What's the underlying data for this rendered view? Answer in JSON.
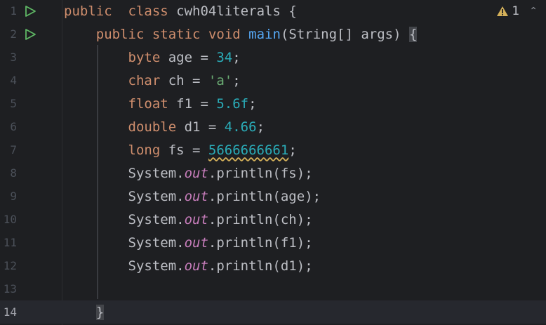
{
  "inspection": {
    "warning_count": "1",
    "warning_icon": "warning-triangle-icon",
    "nav_icon": "chevron-up-icon"
  },
  "colors": {
    "background": "#1e1f22",
    "keyword": "#cf8e6d",
    "number": "#2aacb8",
    "string": "#6aab73",
    "method": "#56a8f5",
    "static_field": "#c77dbb",
    "run_icon": "#5fb865",
    "warning": "#d5b15a"
  },
  "lines": [
    {
      "num": "1",
      "run": true,
      "tokens": [
        [
          "kw",
          "public"
        ],
        [
          "",
          "  "
        ],
        [
          "kw",
          "class"
        ],
        [
          "",
          " cwh04literals {"
        ]
      ]
    },
    {
      "num": "2",
      "run": true,
      "tokens": [
        [
          "",
          "    "
        ],
        [
          "kw",
          "public"
        ],
        [
          "",
          " "
        ],
        [
          "kw",
          "static"
        ],
        [
          "",
          " "
        ],
        [
          "kw",
          "void"
        ],
        [
          "",
          " "
        ],
        [
          "fn",
          "main"
        ],
        [
          "",
          "(String[] args) "
        ],
        [
          "brace",
          "{"
        ]
      ]
    },
    {
      "num": "3",
      "tokens": [
        [
          "",
          "        "
        ],
        [
          "kw",
          "byte"
        ],
        [
          "",
          " age = "
        ],
        [
          "num",
          "34"
        ],
        [
          "",
          ";"
        ]
      ]
    },
    {
      "num": "4",
      "tokens": [
        [
          "",
          "        "
        ],
        [
          "kw",
          "char"
        ],
        [
          "",
          " ch = "
        ],
        [
          "str",
          "'a'"
        ],
        [
          "",
          ";"
        ]
      ]
    },
    {
      "num": "5",
      "tokens": [
        [
          "",
          "        "
        ],
        [
          "kw",
          "float"
        ],
        [
          "",
          " f1 = "
        ],
        [
          "num",
          "5.6f"
        ],
        [
          "",
          ";"
        ]
      ]
    },
    {
      "num": "6",
      "tokens": [
        [
          "",
          "        "
        ],
        [
          "kw",
          "double"
        ],
        [
          "",
          " d1 = "
        ],
        [
          "num",
          "4.66"
        ],
        [
          "",
          ";"
        ]
      ]
    },
    {
      "num": "7",
      "tokens": [
        [
          "",
          "        "
        ],
        [
          "kw",
          "long"
        ],
        [
          "",
          " fs = "
        ],
        [
          "numwarn",
          "5666666661"
        ],
        [
          "",
          ";"
        ]
      ]
    },
    {
      "num": "8",
      "tokens": [
        [
          "",
          "        System."
        ],
        [
          "field",
          "out"
        ],
        [
          "",
          ".println(fs);"
        ]
      ]
    },
    {
      "num": "9",
      "tokens": [
        [
          "",
          "        System."
        ],
        [
          "field",
          "out"
        ],
        [
          "",
          ".println(age);"
        ]
      ]
    },
    {
      "num": "10",
      "tokens": [
        [
          "",
          "        System."
        ],
        [
          "field",
          "out"
        ],
        [
          "",
          ".println(ch);"
        ]
      ]
    },
    {
      "num": "11",
      "tokens": [
        [
          "",
          "        System."
        ],
        [
          "field",
          "out"
        ],
        [
          "",
          ".println(f1);"
        ]
      ]
    },
    {
      "num": "12",
      "tokens": [
        [
          "",
          "        System."
        ],
        [
          "field",
          "out"
        ],
        [
          "",
          ".println(d1);"
        ]
      ]
    },
    {
      "num": "13",
      "tokens": []
    },
    {
      "num": "14",
      "current": true,
      "tokens": [
        [
          "",
          "    "
        ],
        [
          "brace",
          "}"
        ]
      ]
    }
  ]
}
